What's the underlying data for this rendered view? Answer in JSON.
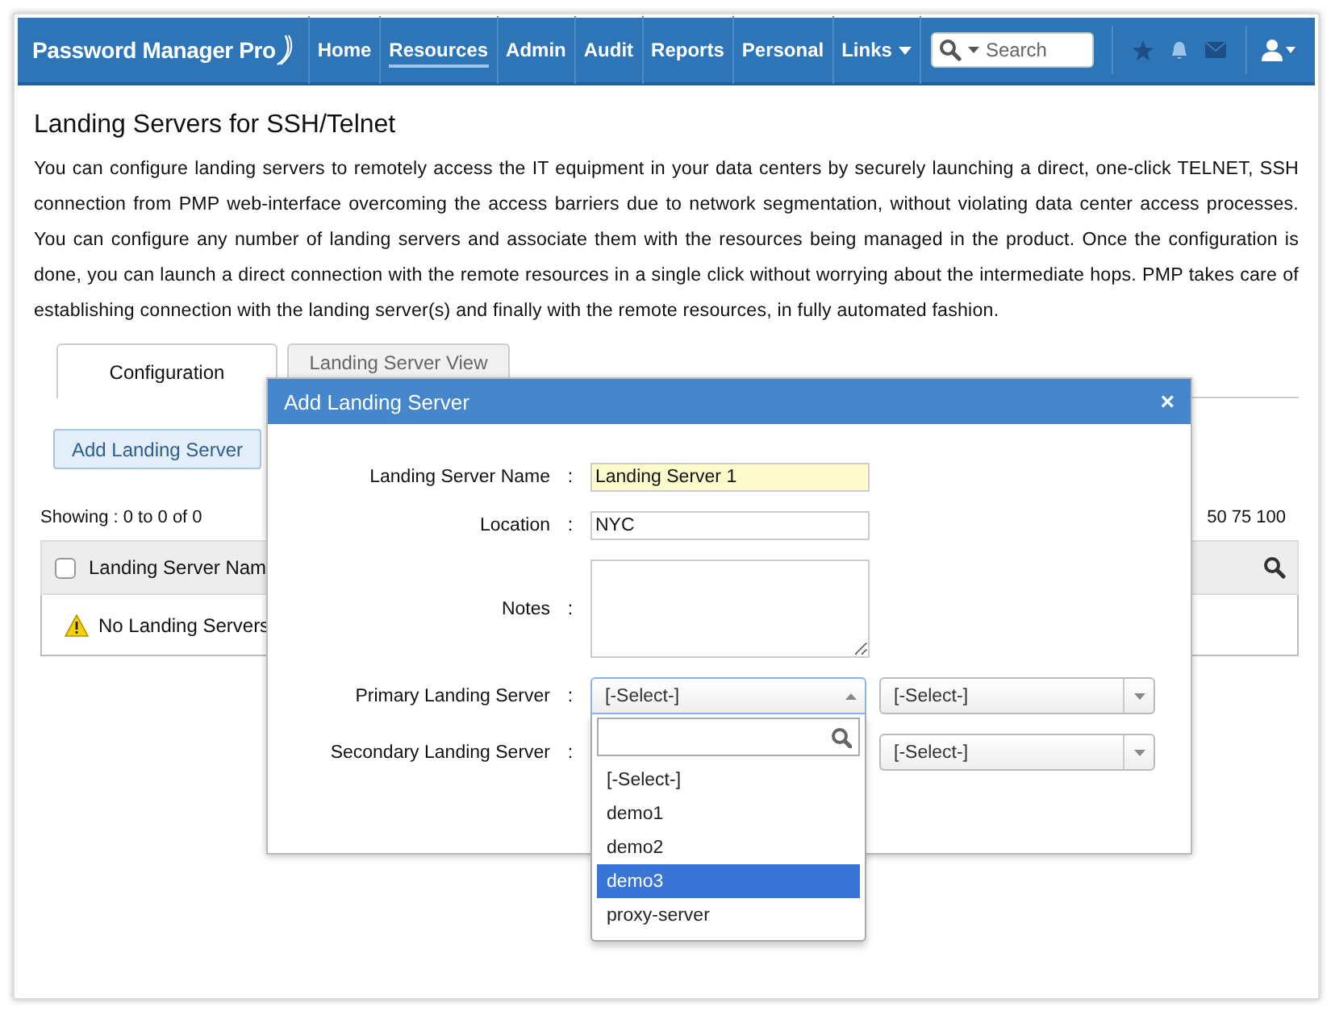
{
  "header": {
    "logo": "Password Manager Pro",
    "nav": [
      {
        "label": "Home",
        "selected": false,
        "menu": false
      },
      {
        "label": "Resources",
        "selected": true,
        "menu": false
      },
      {
        "label": "Admin",
        "selected": false,
        "menu": false
      },
      {
        "label": "Audit",
        "selected": false,
        "menu": false
      },
      {
        "label": "Reports",
        "selected": false,
        "menu": false
      },
      {
        "label": "Personal",
        "selected": false,
        "menu": false
      },
      {
        "label": "Links",
        "selected": false,
        "menu": true
      }
    ],
    "search": {
      "placeholder": "Search"
    }
  },
  "page": {
    "title": "Landing Servers for SSH/Telnet",
    "description": "You can configure landing servers to remotely access the IT equipment in your data centers by securely launching a direct, one-click TELNET, SSH connection from PMP web-interface overcoming the access barriers due to network segmentation, without violating data center access processes. You can configure any number of landing servers and associate them with the resources being managed in the product. Once the configuration is done, you can launch a direct connection with the remote resources in a single click without worrying about the intermediate hops. PMP takes care of establishing connection with the landing server(s) and finally with the remote resources, in fully automated fashion.",
    "tabs": [
      {
        "label": "Configuration",
        "selected": true
      },
      {
        "label": "Landing Server View",
        "selected": false
      }
    ],
    "add_button": "Add Landing Server",
    "showing": "Showing : 0 to 0 of 0",
    "page_sizes": [
      "50",
      "75",
      "100"
    ],
    "table": {
      "columns": [
        "Landing Server Nam"
      ],
      "checked": false,
      "empty_message": "No Landing Servers"
    }
  },
  "dialog": {
    "title": "Add Landing Server",
    "close": "×",
    "fields": [
      {
        "kind": "text",
        "label": "Landing Server Name",
        "separator": ":",
        "value": "Landing Server 1",
        "highlighted": true
      },
      {
        "kind": "text",
        "label": "Location",
        "separator": ":",
        "value": "NYC",
        "highlighted": false
      },
      {
        "kind": "textarea",
        "label": "Notes",
        "separator": ":",
        "highlighted": false
      },
      {
        "kind": "select",
        "label": "Primary Landing Server",
        "separator": ":",
        "selects": [
          {
            "value": "[-Select-]",
            "open": true
          },
          {
            "value": "[-Select-]",
            "open": false
          }
        ],
        "options": [
          {
            "label": "[-Select-]",
            "selected": false
          },
          {
            "label": "demo1",
            "selected": false
          },
          {
            "label": "demo2",
            "selected": false
          },
          {
            "label": "demo3",
            "selected": true
          },
          {
            "label": "proxy-server",
            "selected": false
          }
        ]
      },
      {
        "kind": "select",
        "label": "Secondary Landing Server",
        "separator": ":",
        "selects": [
          {
            "value": "[-Select-]",
            "open": false
          }
        ]
      }
    ]
  }
}
